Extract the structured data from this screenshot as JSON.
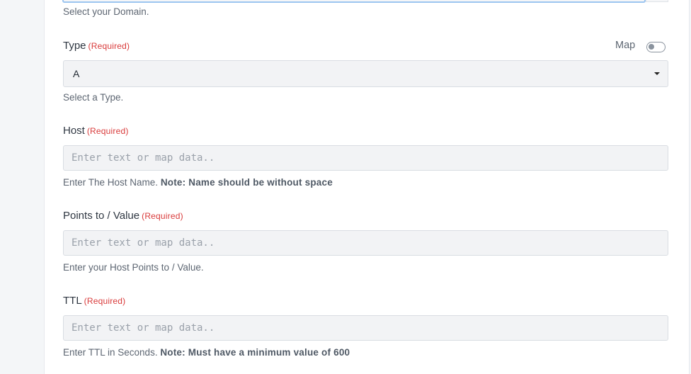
{
  "domain_field": {
    "help": "Select your Domain."
  },
  "type_field": {
    "label": "Type",
    "required": "(Required)",
    "map_label": "Map",
    "map_toggle_on": false,
    "value": "A",
    "help": "Select a Type."
  },
  "host_field": {
    "label": "Host",
    "required": "(Required)",
    "placeholder": "Enter text or map data..",
    "help": "Enter The Host Name.",
    "note": "Note: Name should be without space"
  },
  "points_field": {
    "label": "Points to / Value",
    "required": "(Required)",
    "placeholder": "Enter text or map data..",
    "help": "Enter your Host Points to / Value."
  },
  "ttl_field": {
    "label": "TTL",
    "required": "(Required)",
    "placeholder": "Enter text or map data..",
    "help": "Enter TTL in Seconds.",
    "note": "Note: Must have a minimum value of 600"
  }
}
